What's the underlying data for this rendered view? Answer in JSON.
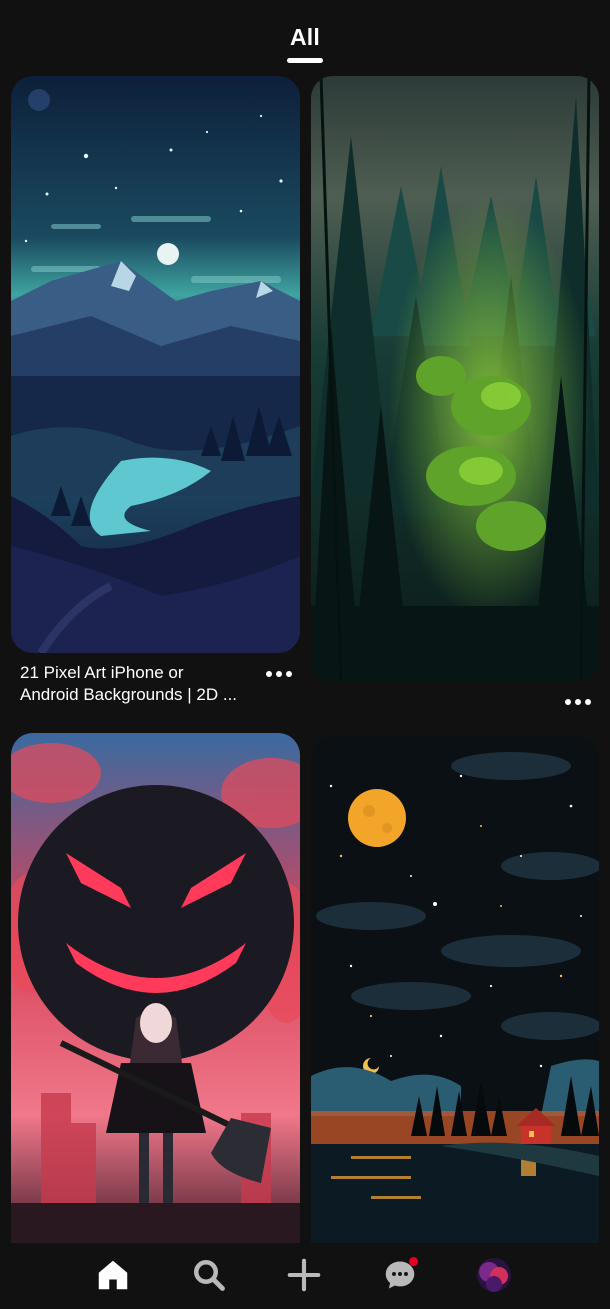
{
  "top_tabs": {
    "active_label": "All"
  },
  "feed": {
    "pins": [
      {
        "image_name": "pixel-art-mountain-night",
        "title_line1": "21 Pixel Art iPhone or",
        "title_line2": "Android Backgrounds | 2D ..."
      },
      {
        "image_name": "dark-forest"
      },
      {
        "image_name": "anime-girl-axe-moon"
      },
      {
        "image_name": "starry-night-lake-cabin"
      }
    ]
  },
  "bottom_nav": {
    "items": [
      {
        "icon": "home-icon",
        "active": true
      },
      {
        "icon": "search-icon"
      },
      {
        "icon": "plus-icon"
      },
      {
        "icon": "chat-bubble-icon",
        "has_notification": true
      },
      {
        "icon": "profile-avatar"
      }
    ],
    "notification_color": "#e60023"
  },
  "colors": {
    "background": "#111111",
    "text": "#ffffff"
  }
}
